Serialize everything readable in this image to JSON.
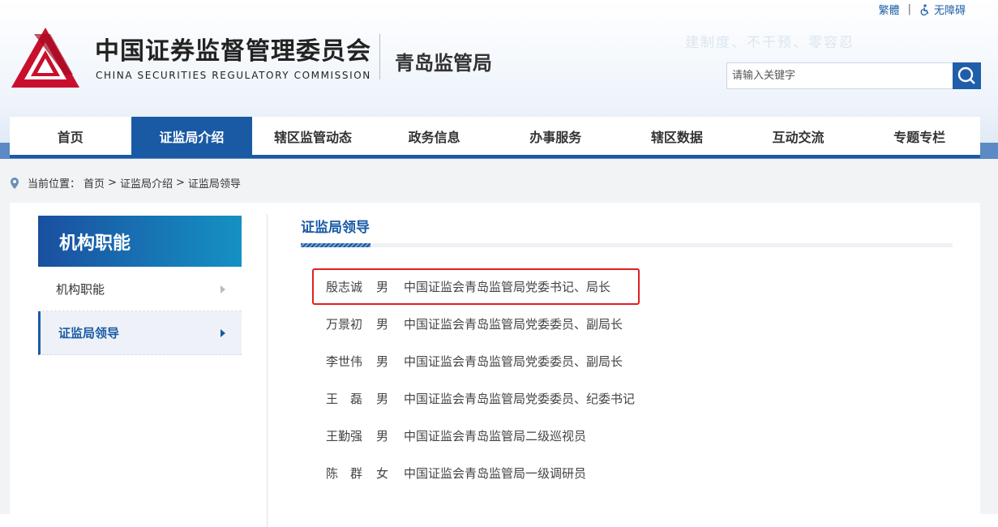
{
  "top_links": {
    "traditional": "繁體",
    "separator": "|",
    "accessibility": "无障碍"
  },
  "header": {
    "org_cn": "中国证券监督管理委员会",
    "org_en": "CHINA SECURITIES REGULATORY COMMISSION",
    "bureau": "青岛监管局",
    "slogan": "建制度、不干预、零容忍"
  },
  "search": {
    "placeholder": "请输入关键字"
  },
  "nav": {
    "items": [
      {
        "label": "首页"
      },
      {
        "label": "证监局介绍"
      },
      {
        "label": "辖区监管动态"
      },
      {
        "label": "政务信息"
      },
      {
        "label": "办事服务"
      },
      {
        "label": "辖区数据"
      },
      {
        "label": "互动交流"
      },
      {
        "label": "专题专栏"
      }
    ],
    "active": "证监局介绍"
  },
  "breadcrumb": {
    "prefix": "当前位置：",
    "items": [
      "首页",
      "证监局介绍",
      "证监局领导"
    ],
    "sep": ">"
  },
  "sidebar": {
    "title": "机构职能",
    "items": [
      {
        "label": "机构职能"
      },
      {
        "label": "证监局领导"
      }
    ]
  },
  "content": {
    "title": "证监局领导",
    "leaders": [
      {
        "name": "殷志诚",
        "gender": "男",
        "title": "中国证监会青岛监管局党委书记、局长"
      },
      {
        "name": "万景初",
        "gender": "男",
        "title": "中国证监会青岛监管局党委委员、副局长"
      },
      {
        "name": "李世伟",
        "gender": "男",
        "title": "中国证监会青岛监管局党委委员、副局长"
      },
      {
        "name": "王　磊",
        "gender": "男",
        "title": "中国证监会青岛监管局党委委员、纪委书记"
      },
      {
        "name": "王勤强",
        "gender": "男",
        "title": "中国证监会青岛监管局二级巡视员"
      },
      {
        "name": "陈　群",
        "gender": "女",
        "title": "中国证监会青岛监管局一级调研员"
      }
    ]
  },
  "colors": {
    "brand_blue": "#1a5aa5",
    "logo_red": "#c8102e",
    "highlight_red": "#e02020"
  }
}
